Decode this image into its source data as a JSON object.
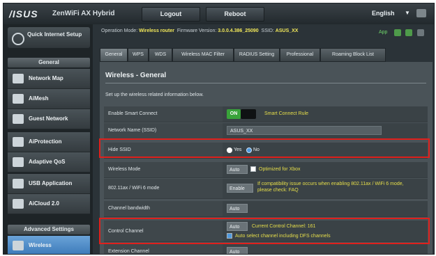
{
  "header": {
    "logo": "/ISUS",
    "model": "ZenWiFi AX Hybrid",
    "logout_label": "Logout",
    "reboot_label": "Reboot",
    "language": "English"
  },
  "sidebar": {
    "quick_setup": "Quick Internet Setup",
    "general_header": "General",
    "general_items": [
      {
        "label": "Network Map",
        "icon": "network-map-icon"
      },
      {
        "label": "AiMesh",
        "icon": "aimesh-icon"
      },
      {
        "label": "Guest Network",
        "icon": "guest-network-icon"
      },
      {
        "label": "AiProtection",
        "icon": "aiprotection-icon"
      },
      {
        "label": "Adaptive QoS",
        "icon": "adaptive-qos-icon"
      },
      {
        "label": "USB Application",
        "icon": "usb-application-icon"
      },
      {
        "label": "AiCloud 2.0",
        "icon": "aicloud-icon"
      }
    ],
    "advanced_header": "Advanced Settings",
    "advanced_items": [
      {
        "label": "Wireless",
        "icon": "wireless-icon",
        "active": true
      }
    ]
  },
  "status": {
    "operation_mode_label": "Operation Mode:",
    "operation_mode_value": "Wireless router",
    "firmware_label": "Firmware Version:",
    "firmware_value": "3.0.0.4.386_25090",
    "ssid_label": "SSID:",
    "ssid_value": "ASUS_XX",
    "app_label": "App"
  },
  "tabs": [
    "General",
    "WPS",
    "WDS",
    "Wireless MAC Filter",
    "RADIUS Setting",
    "Professional",
    "Roaming Block List"
  ],
  "active_tab": "General",
  "panel": {
    "title": "Wireless - General",
    "description": "Set up the wireless related information below.",
    "rows": {
      "smart_connect": {
        "label": "Enable Smart Connect",
        "toggle": "ON",
        "link": "Smart Connect Rule"
      },
      "network_name": {
        "label": "Network Name (SSID)",
        "value": "ASUS_XX"
      },
      "hide_ssid": {
        "label": "Hide SSID",
        "yes": "Yes",
        "no": "No",
        "selected": "No"
      },
      "wireless_mode": {
        "label": "Wireless Mode",
        "select": "Auto",
        "checkbox_label": "Optimized for Xbox"
      },
      "auth_method": {
        "label": "802.11ax / WiFi 6 mode",
        "select": "Enable",
        "note": "If compatibility issue occurs when enabling 802.11ax / WiFi 6 mode, please check: FAQ"
      },
      "channel_bandwidth": {
        "label": "Channel bandwidth",
        "select": "Auto"
      },
      "control_channel": {
        "label": "Control Channel",
        "select": "Auto",
        "current": "Current Control Channel: 161",
        "checkbox_label": "Auto select channel including DFS channels",
        "checked": true
      },
      "extension_channel": {
        "label": "Extension Channel",
        "select": "Auto"
      }
    }
  },
  "colors": {
    "accent_yellow": "#e7df4a",
    "highlight_red": "#e0201c",
    "active_blue": "#3b79b8",
    "toggle_green": "#39a33a"
  }
}
